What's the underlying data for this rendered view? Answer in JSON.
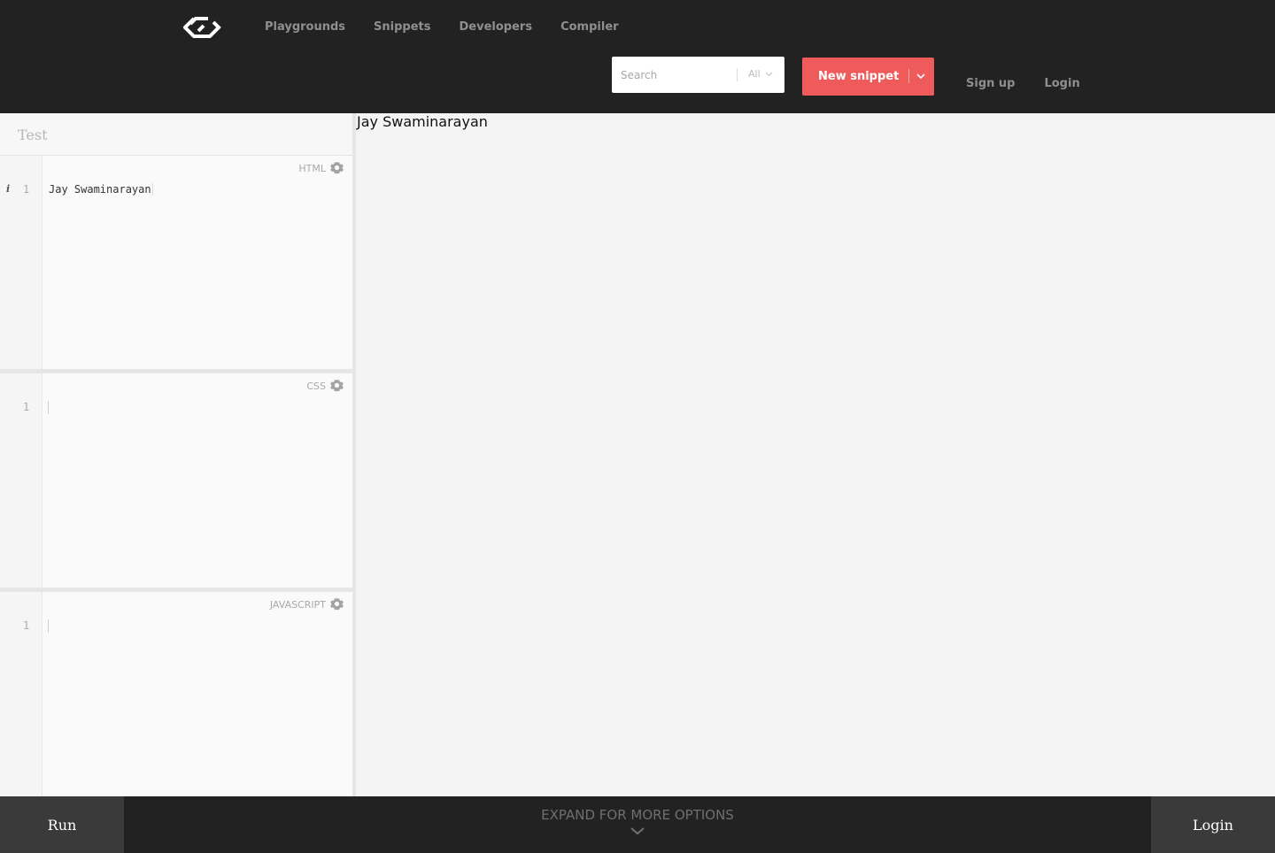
{
  "header": {
    "nav": [
      "Playgrounds",
      "Snippets",
      "Developers",
      "Compiler"
    ],
    "search_placeholder": "Search",
    "search_scope": "All",
    "new_snippet_label": "New snippet",
    "signup_label": "Sign up",
    "login_label": "Login"
  },
  "editor": {
    "title_placeholder": "Test",
    "panels": [
      {
        "lang": "HTML",
        "line": "1",
        "code": "Jay Swaminarayan"
      },
      {
        "lang": "CSS",
        "line": "1",
        "code": ""
      },
      {
        "lang": "JAVASCRIPT",
        "line": "1",
        "code": ""
      }
    ]
  },
  "preview": {
    "output": "Jay Swaminarayan"
  },
  "footer": {
    "run_label": "Run",
    "expand_label": "EXPAND FOR MORE OPTIONS",
    "login_label": "Login"
  },
  "colors": {
    "topbar": "#222222",
    "accent": "#ef5b5b"
  },
  "icons": [
    "logo-icon",
    "chevron-down-icon",
    "gear-icon",
    "info-icon"
  ]
}
